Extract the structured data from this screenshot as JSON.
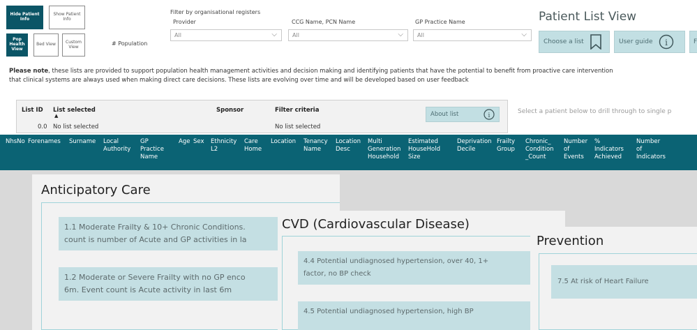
{
  "nav": {
    "hide_patient_info": "Hide Patient Info",
    "show_patient_info": "Show Patient Info",
    "pop_health_view": "Pop Health View",
    "bed_view": "Bed View",
    "custom_view": "Custom View",
    "population_label": "# Population"
  },
  "filters": {
    "heading": "Filter by organisational registers",
    "provider_label": "Provider",
    "provider_value": "All",
    "ccg_label": "CCG Name, PCN Name",
    "ccg_value": "All",
    "gp_label": "GP Practice Name",
    "gp_value": "All"
  },
  "header": {
    "title": "Patient List View",
    "choose_list": "Choose a list",
    "user_guide": "User guide",
    "cut_button": "F"
  },
  "note": {
    "bold": "Please note",
    "line1": ", these lists are provided to support population health management activities and decision making and identifying patients that have the potential to benefit from proactive care intervention",
    "line2": "that clinical systems are always used when making direct care decisions. These lists are evolving over time and will be developed based on user feedback"
  },
  "list_table": {
    "headers": {
      "id": "List ID",
      "selected": "List selected",
      "sponsor": "Sponsor",
      "criteria": "Filter criteria"
    },
    "row": {
      "id": "0.0",
      "selected": "No list selected",
      "criteria": "No list selected"
    },
    "about": "About list",
    "drill_hint": "Select a patient below to drill through to single p"
  },
  "patient_table": {
    "columns": [
      "NhsNo",
      "Forenames",
      "Surname",
      "Local\nAuthority",
      "GP\nPractice\nName",
      "Age",
      "Sex",
      "Ethnicity\nL2",
      "Care\nHome",
      "Location",
      "Tenancy\nName",
      "Location\nDesc",
      "Multi\nGeneration\nHousehold",
      "Estimated\nHouseHold\nSize",
      "Deprivation\nDecile",
      "Frailty\nGroup",
      "Chronic_\nCondition\n_Count",
      "Number\nof\nEvents",
      "%\nIndicators\nAchieved",
      "Number\nof\nIndicators"
    ]
  },
  "cards": {
    "anticipatory": {
      "title": "Anticipatory Care",
      "items": [
        "1.1 Moderate Frailty & 10+ Chronic Conditions.\ncount is number of Acute and GP activities in la",
        "1.2 Moderate or Severe Frailty with no GP enco\n6m. Event count is Acute activity in last 6m"
      ]
    },
    "cvd": {
      "title": "CVD (Cardiovascular Disease)",
      "items": [
        "4.4 Potential undiagnosed hypertension, over 40, 1+\nfactor, no BP check",
        "4.5 Potential undiagnosed hypertension, high BP"
      ]
    },
    "prevention": {
      "title": "Prevention",
      "items": [
        "7.5 At risk of Heart Failure"
      ]
    }
  },
  "colors": {
    "teal_dark": "#0b6374",
    "teal_light": "#c4dfe3",
    "card_bg": "#f2f2f2"
  }
}
